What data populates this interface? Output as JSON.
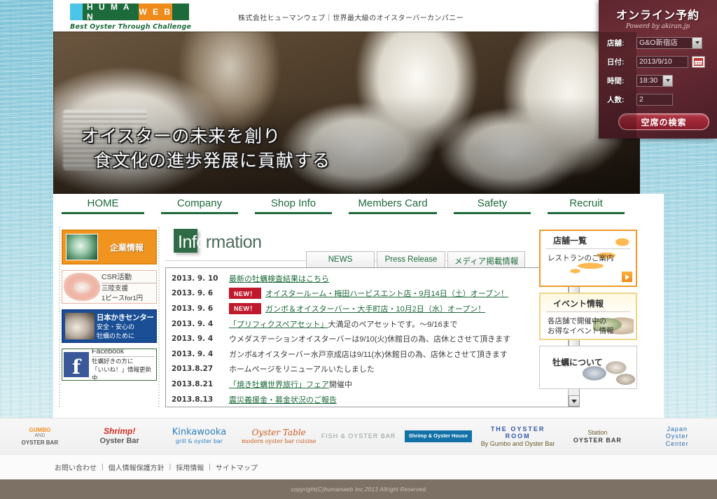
{
  "header": {
    "logo_letters": [
      "H U M A N",
      "W E B"
    ],
    "tagline": "Best Oyster Through Challenge",
    "company_line": "株式会社ヒューマンウェブ｜世界最大級のオイスターバーカンパニー"
  },
  "reservation": {
    "title": "オンライン予約",
    "powered_by": "Powerd by akiran.jp",
    "fields": [
      {
        "label": "店舗:",
        "value": "G&O新宿店"
      },
      {
        "label": "日付:",
        "value": "2013/9/10"
      },
      {
        "label": "時間:",
        "value": "18:30"
      },
      {
        "label": "人数:",
        "value": "2"
      }
    ],
    "search_button": "空席の検索"
  },
  "hero": {
    "line1": "オイスターの未来を創り",
    "line2": "食文化の進歩発展に貢献する"
  },
  "nav": {
    "items": [
      {
        "label": "HOME"
      },
      {
        "label": "Company"
      },
      {
        "label": "Shop Info"
      },
      {
        "label": "Members Card"
      },
      {
        "label": "Safety"
      },
      {
        "label": "Recruit"
      }
    ]
  },
  "left_banners": [
    {
      "title": "企業情報"
    },
    {
      "title": "CSR活動",
      "line1": "三陸支援",
      "line2": "1ピースfor1円"
    },
    {
      "title": "日本かきセンター",
      "line1": "安全・安心の",
      "line2": "牡蠣のために"
    },
    {
      "title": "Facebook",
      "line1": "牡蠣好きの方に",
      "line2": "「いいね！」情報更新中"
    }
  ],
  "information": {
    "heading_white": "Info",
    "heading_rest": "rmation",
    "tabs": [
      {
        "label": "NEWS",
        "active": true
      },
      {
        "label": "Press Release",
        "active": false
      },
      {
        "label": "メディア掲載情報",
        "active": false
      }
    ],
    "news": [
      {
        "date": "2013. 9. 10",
        "badge": "",
        "text": "最新の牡蠣検査結果はこちら",
        "link": true
      },
      {
        "date": "2013. 9. 6",
        "badge": "NEW！",
        "text": "オイスタールーム・梅田ハービスエント店・9月14日（土）オープン！",
        "link": true
      },
      {
        "date": "2013. 9. 6",
        "badge": "NEW！",
        "text": "ガンボ＆オイスターバー・大手町店・10月2日（水）オープン！",
        "link": true
      },
      {
        "date": "2013. 9. 4",
        "badge": "",
        "text": "「プリフィクスペアセット」",
        "text_plain": "大満足のペアセットです。～9/16まで",
        "link": true
      },
      {
        "date": "2013. 9. 4",
        "badge": "",
        "text": "ウメダステーションオイスターバーは9/10(火)休館日の為、店休とさせて頂きます",
        "link": false
      },
      {
        "date": "2013. 9. 4",
        "badge": "",
        "text": "ガンボ&オイスターバー水戸京成店は9/11(水)休館日の為、店休とさせて頂きます",
        "link": false
      },
      {
        "date": "2013.8.27",
        "badge": "",
        "text": "ホームページをリニューアルいたしました",
        "link": false
      },
      {
        "date": "2013.8.21",
        "badge": "",
        "text": "「焼き牡蠣世界旅行」フェア",
        "text_plain": "開催中",
        "link": true
      },
      {
        "date": "2013.8.13",
        "badge": "",
        "text": "震災義援金・募金状況のご報告",
        "link": true
      }
    ]
  },
  "right_boxes": [
    {
      "title": "店舗一覧",
      "sub": "レストランのご案内"
    },
    {
      "title": "イベント情報",
      "sub": "各店舗で開催中の\nお得なイベント情報"
    },
    {
      "title": "牡蠣について",
      "sub": ""
    }
  ],
  "brands": [
    {
      "name": "gumbo-and-oyster-bar",
      "l1": "GUMBO",
      "l2": "AND",
      "l3": "OYSTER BAR"
    },
    {
      "name": "shrimp-and-oyster-bar",
      "l1": "Shrimp!",
      "l2": "Oyster Bar"
    },
    {
      "name": "kinkawooka",
      "l1": "Kinkawooka",
      "l2": "grill & oyster bar"
    },
    {
      "name": "oyster-table",
      "l1": "Oyster Table",
      "l2": "modern oyster bar cuisine"
    },
    {
      "name": "fish-and-oyster-bar",
      "l1": "FISH & OYSTER BAR",
      "l2": ""
    },
    {
      "name": "shrimp-oyster-house",
      "l1": "Shrimp & Oyster House",
      "l2": ""
    },
    {
      "name": "the-oyster-room",
      "l1": "THE OYSTER ROOM",
      "l2": "By Gumbo and Oyster Bar"
    },
    {
      "name": "station-oyster-bar",
      "l1": "Station",
      "l2": "OYSTER BAR"
    },
    {
      "name": "japan-oyster-center",
      "l1": "Japan",
      "l2": "Oyster",
      "l3": "Center"
    }
  ],
  "footer": {
    "links": [
      "お問い合わせ",
      "個人情報保護方針",
      "採用情報",
      "サイトマップ"
    ],
    "separator": "|",
    "copyright": "copyright(C)humanweb Inc.2013 Allright Reserved"
  },
  "colors": {
    "brand_green": "#1d6b3a",
    "brand_orange": "#f08a1b",
    "resv_maroon": "#5e2630",
    "badge_red": "#c0182c"
  }
}
